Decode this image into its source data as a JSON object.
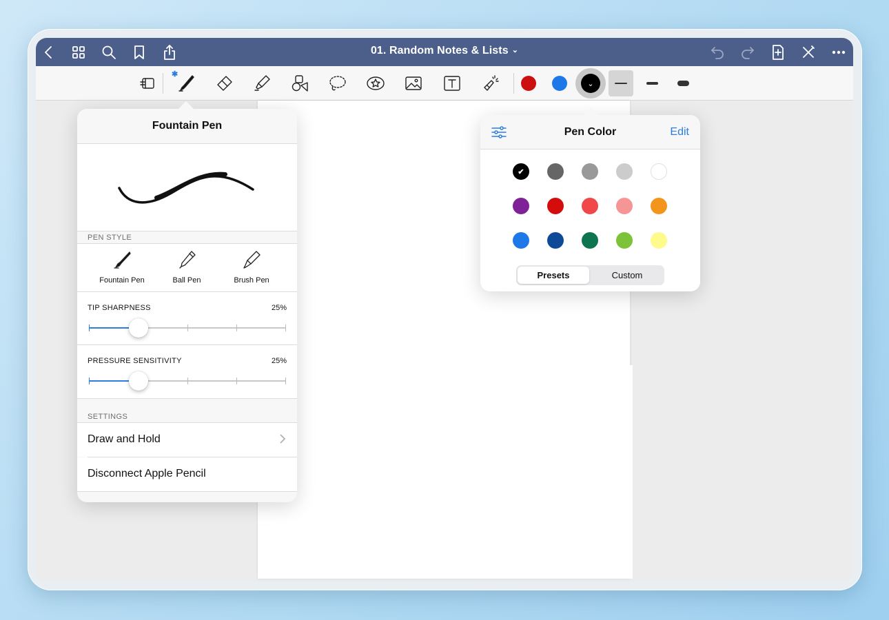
{
  "app": {
    "doc_title": "01. Random Notes & Lists",
    "title_chevron": "⌄"
  },
  "navbar": {
    "left_icons": [
      "back-icon",
      "grid-icon",
      "search-icon",
      "bookmark-icon",
      "share-icon"
    ],
    "right_icons": [
      "undo-icon",
      "redo-icon",
      "add-page-icon",
      "close-icon",
      "more-icon"
    ]
  },
  "toolbar": {
    "tools": [
      "read-only-icon",
      "pen-icon",
      "eraser-icon",
      "highlighter-icon",
      "shapes-icon",
      "lasso-icon",
      "sticker-icon",
      "image-icon",
      "text-icon",
      "laser-pointer-icon"
    ],
    "bluetooth_mark": "✱",
    "quick_colors": [
      "#cc0f0f",
      "#1e78e8"
    ],
    "selected_color": "#000000",
    "selected_color_chevron": "⌄",
    "widths": [
      {
        "label": "thin",
        "selected": true
      },
      {
        "label": "medium",
        "selected": false
      },
      {
        "label": "thick",
        "selected": false
      }
    ]
  },
  "pen_panel": {
    "title": "Fountain Pen",
    "pen_style_header": "PEN STYLE",
    "styles": [
      {
        "label": "Fountain Pen",
        "icon": "fountain-pen-icon",
        "selected": true
      },
      {
        "label": "Ball Pen",
        "icon": "ball-pen-icon",
        "selected": false
      },
      {
        "label": "Brush Pen",
        "icon": "brush-pen-icon",
        "selected": false
      }
    ],
    "tip_sharpness": {
      "label": "TIP SHARPNESS",
      "value_text": "25%",
      "value": 0.25
    },
    "pressure_sensitivity": {
      "label": "PRESSURE SENSITIVITY",
      "value_text": "25%",
      "value": 0.25
    },
    "settings_header": "SETTINGS",
    "draw_and_hold": "Draw and Hold",
    "disconnect": "Disconnect Apple Pencil"
  },
  "color_panel": {
    "title": "Pen Color",
    "edit_label": "Edit",
    "selected_index": 0,
    "colors": [
      "#000000",
      "#666666",
      "#999999",
      "#cccccc",
      "#ffffff",
      "#7f2197",
      "#d40c0c",
      "#f04848",
      "#f59595",
      "#f3951c",
      "#1e78e8",
      "#0e4a98",
      "#0e7550",
      "#7cc33a",
      "#fefb8c"
    ],
    "check_mark": "✔",
    "segments": [
      {
        "label": "Presets",
        "selected": true
      },
      {
        "label": "Custom",
        "selected": false
      }
    ]
  }
}
